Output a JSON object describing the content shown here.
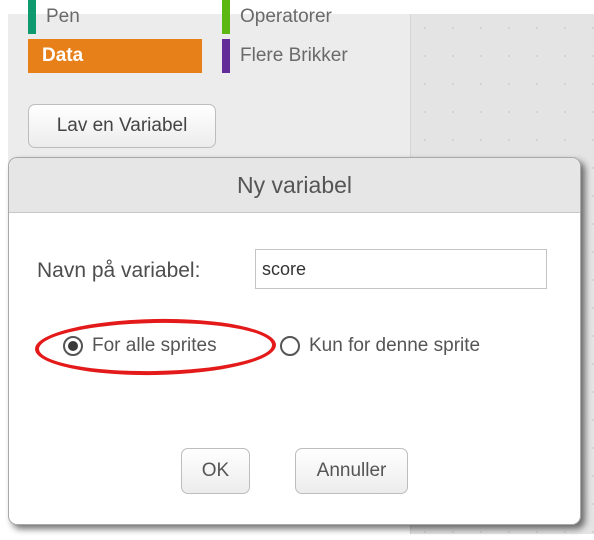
{
  "palette": {
    "categories": [
      {
        "label": "Pen",
        "color": "#0e9a6c"
      },
      {
        "label": "Operatorer",
        "color": "#5cb712"
      },
      {
        "label": "Data",
        "color": "#ee7d16",
        "selected": true
      },
      {
        "label": "Flere Brikker",
        "color": "#632d99"
      }
    ],
    "make_variable_label": "Lav en Variabel"
  },
  "dialog": {
    "title": "Ny variabel",
    "name_label": "Navn på variabel:",
    "name_value": "score",
    "option_all": "For alle sprites",
    "option_this": "Kun for denne sprite",
    "selected_option": "For alle sprites",
    "ok_label": "OK",
    "cancel_label": "Annuller"
  },
  "annotation": {
    "highlight_color": "#e41a1a"
  }
}
